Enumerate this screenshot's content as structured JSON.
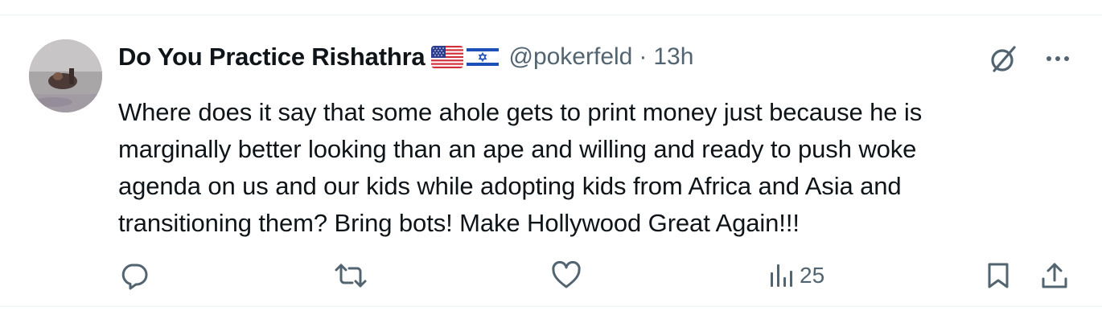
{
  "tweet": {
    "author_name": "Do You Practice Rishathra",
    "flags": [
      "us-flag-icon",
      "israel-flag-icon"
    ],
    "handle": "@pokerfeld",
    "separator": "·",
    "time": "13h",
    "text": "Where does it say that some ahole gets to print money just because he is\nmarginally better looking than an ape and willing and ready to push woke\nagenda on us and our kids while adopting kids from Africa and Asia and\ntransitioning them? Bring bots! Make Hollywood Great Again!!!",
    "views": "25"
  },
  "icons": {
    "reply": "reply-icon",
    "retweet": "retweet-icon",
    "like": "heart-icon",
    "views": "views-bar-icon",
    "bookmark": "bookmark-icon",
    "share": "share-icon",
    "grok": "grok-icon",
    "more": "more-icon"
  },
  "colors": {
    "text": "#0f1419",
    "secondary": "#536471",
    "border": "#eff3f4"
  }
}
